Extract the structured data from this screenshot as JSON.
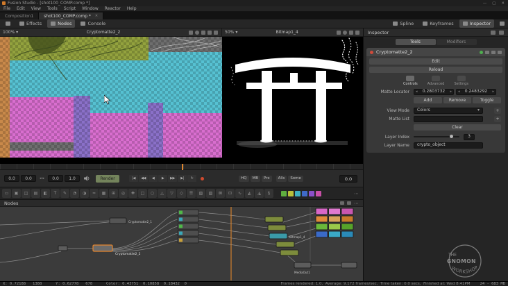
{
  "colors": {
    "accent_orange": "#e0862c",
    "render_button": "#74845c",
    "cyan_matte": "#56c1d2",
    "magenta_matte": "#d96ecf",
    "purple_matte": "#8a70c8",
    "olive_matte": "#93a23e",
    "orange_matte": "#c9894a",
    "gray_checker": "#6e6e6e",
    "selected_node": "#e8862c"
  },
  "window": {
    "title": "Fusion Studio - [shot100_COMP.comp *]",
    "menus": [
      "File",
      "Edit",
      "View",
      "Tools",
      "Script",
      "Window",
      "Reactor",
      "Help"
    ],
    "min": "—",
    "max": "▢",
    "close": "✕"
  },
  "tabs": {
    "tab1": "Composition1",
    "tab2": "shot100_COMP.comp *",
    "close": "✕"
  },
  "toolbar": {
    "effects": "Effects",
    "nodes": "Nodes",
    "console": "Console",
    "spline": "Spline",
    "keyframes": "Keyframes",
    "inspector": "Inspector"
  },
  "viewers": {
    "left_title": "Cryptomatte2_2",
    "left_zoom": "100%",
    "right_title": "Bitmap1_4",
    "right_zoom": "50%",
    "caret": "▾"
  },
  "inspector": {
    "title": "Inspector",
    "tools_tab": "Tools",
    "modifiers_tab": "Modifiers",
    "node_name": "Cryptomatte2_2",
    "edit": "Edit",
    "reload": "Reload",
    "subtabs": [
      "Controls",
      "Advanced",
      "Settings"
    ],
    "matte_locator_label": "Matte Locator",
    "matte_x": "0.2803732",
    "matte_y": "0.2483292",
    "add": "Add",
    "remove": "Remove",
    "toggle": "Toggle",
    "view_mode_label": "View Mode",
    "view_mode_value": "Colors",
    "matte_list_label": "Matte List",
    "clear": "Clear",
    "layer_index_label": "Layer Index",
    "layer_index_value": "3",
    "layer_name_label": "Layer Name",
    "layer_name_value": "crypto_object",
    "caret": "▾",
    "plus": "+",
    "stepper_left": "◂",
    "stepper_right": "▸"
  },
  "transport": {
    "fields": [
      "0.0",
      "0.0",
      "0.0",
      "1.0"
    ],
    "stepper_left": "◂",
    "stepper_right": "▸",
    "render": "Render",
    "buttons": [
      "|◀",
      "◀◀",
      "◀",
      "▶",
      "▶▶",
      "▶|",
      "↻"
    ],
    "toggles": [
      "HQ",
      "MB",
      "Prx",
      "Alls",
      "Some"
    ],
    "current_frame": "0.0"
  },
  "toolrow": {
    "icons": [
      "▭",
      "▣",
      "◫",
      "▤",
      "◧",
      "T",
      "✎",
      "◔",
      "◑",
      "≈",
      "▦",
      "⊞",
      "◎",
      "✚",
      "□",
      "○",
      "△",
      "▽",
      "◇",
      "☰",
      "▧",
      "▨",
      "⊠",
      "⊡",
      "∿",
      "◭",
      "◮",
      "§"
    ],
    "swatches": [
      "#5fae3f",
      "#b8c03a",
      "#3fb0c0",
      "#3f6ac8",
      "#8a50c8",
      "#c850a8"
    ],
    "more": "⋯"
  },
  "nodes_panel": {
    "title": "Nodes",
    "menu": "⋯",
    "labels": {
      "crypto1": "Cryptomatte2_1",
      "crypto2": "Cryptomatte2_2",
      "bitmap": "Bitmap1_4",
      "mediaout": "MediaOut1"
    },
    "chip_colors": [
      "#4fb848",
      "#3aa8b8",
      "#4fb848",
      "#3aa8b8",
      "#c8a03a"
    ],
    "tile_colors": [
      "#d867c8",
      "#e07ad0",
      "#c857b0",
      "#e08a3a",
      "#d8a35a",
      "#c87a2a",
      "#6ab83a",
      "#9aca4a",
      "#57a32a",
      "#3a6ac8",
      "#3aaac8",
      "#2a8ab8"
    ]
  },
  "status_bar": {
    "readout": "X: 0.72188   1388      Y: 0.62778   678      Color: 0.43751  0.10858  0.18432  0",
    "render_info": "Frames rendered: 1.0,  Average: 9.172 frames/sec,  Time taken: 0.0 secs,  Finished at: Wed 8:41PM",
    "memory": "24 - 683 MB"
  },
  "watermark": {
    "the": "THE",
    "gnomon": "GNOMON",
    "workshop": "WORKSHOP"
  }
}
